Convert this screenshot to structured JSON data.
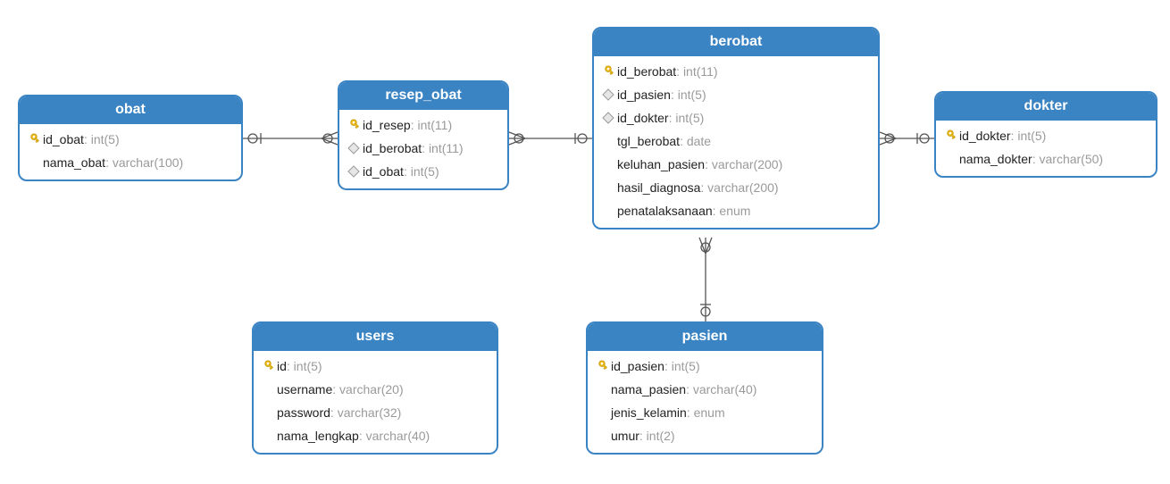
{
  "entities": {
    "obat": {
      "title": "obat",
      "columns": [
        {
          "icon": "pk",
          "name": "id_obat",
          "type": "int(5)"
        },
        {
          "icon": "",
          "name": "nama_obat",
          "type": "varchar(100)"
        }
      ]
    },
    "resep_obat": {
      "title": "resep_obat",
      "columns": [
        {
          "icon": "pk",
          "name": "id_resep",
          "type": "int(11)"
        },
        {
          "icon": "fk",
          "name": "id_berobat",
          "type": "int(11)"
        },
        {
          "icon": "fk",
          "name": "id_obat",
          "type": "int(5)"
        }
      ]
    },
    "berobat": {
      "title": "berobat",
      "columns": [
        {
          "icon": "pk",
          "name": "id_berobat",
          "type": "int(11)"
        },
        {
          "icon": "fk",
          "name": "id_pasien",
          "type": "int(5)"
        },
        {
          "icon": "fk",
          "name": "id_dokter",
          "type": "int(5)"
        },
        {
          "icon": "",
          "name": "tgl_berobat",
          "type": "date"
        },
        {
          "icon": "",
          "name": "keluhan_pasien",
          "type": "varchar(200)"
        },
        {
          "icon": "",
          "name": "hasil_diagnosa",
          "type": "varchar(200)"
        },
        {
          "icon": "",
          "name": "penatalaksanaan",
          "type": "enum"
        }
      ]
    },
    "dokter": {
      "title": "dokter",
      "columns": [
        {
          "icon": "pk",
          "name": "id_dokter",
          "type": "int(5)"
        },
        {
          "icon": "",
          "name": "nama_dokter",
          "type": "varchar(50)"
        }
      ]
    },
    "users": {
      "title": "users",
      "columns": [
        {
          "icon": "pk",
          "name": "id",
          "type": "int(5)"
        },
        {
          "icon": "",
          "name": "username",
          "type": "varchar(20)"
        },
        {
          "icon": "",
          "name": "password",
          "type": "varchar(32)"
        },
        {
          "icon": "",
          "name": "nama_lengkap",
          "type": "varchar(40)"
        }
      ]
    },
    "pasien": {
      "title": "pasien",
      "columns": [
        {
          "icon": "pk",
          "name": "id_pasien",
          "type": "int(5)"
        },
        {
          "icon": "",
          "name": "nama_pasien",
          "type": "varchar(40)"
        },
        {
          "icon": "",
          "name": "jenis_kelamin",
          "type": "enum"
        },
        {
          "icon": "",
          "name": "umur",
          "type": "int(2)"
        }
      ]
    }
  }
}
